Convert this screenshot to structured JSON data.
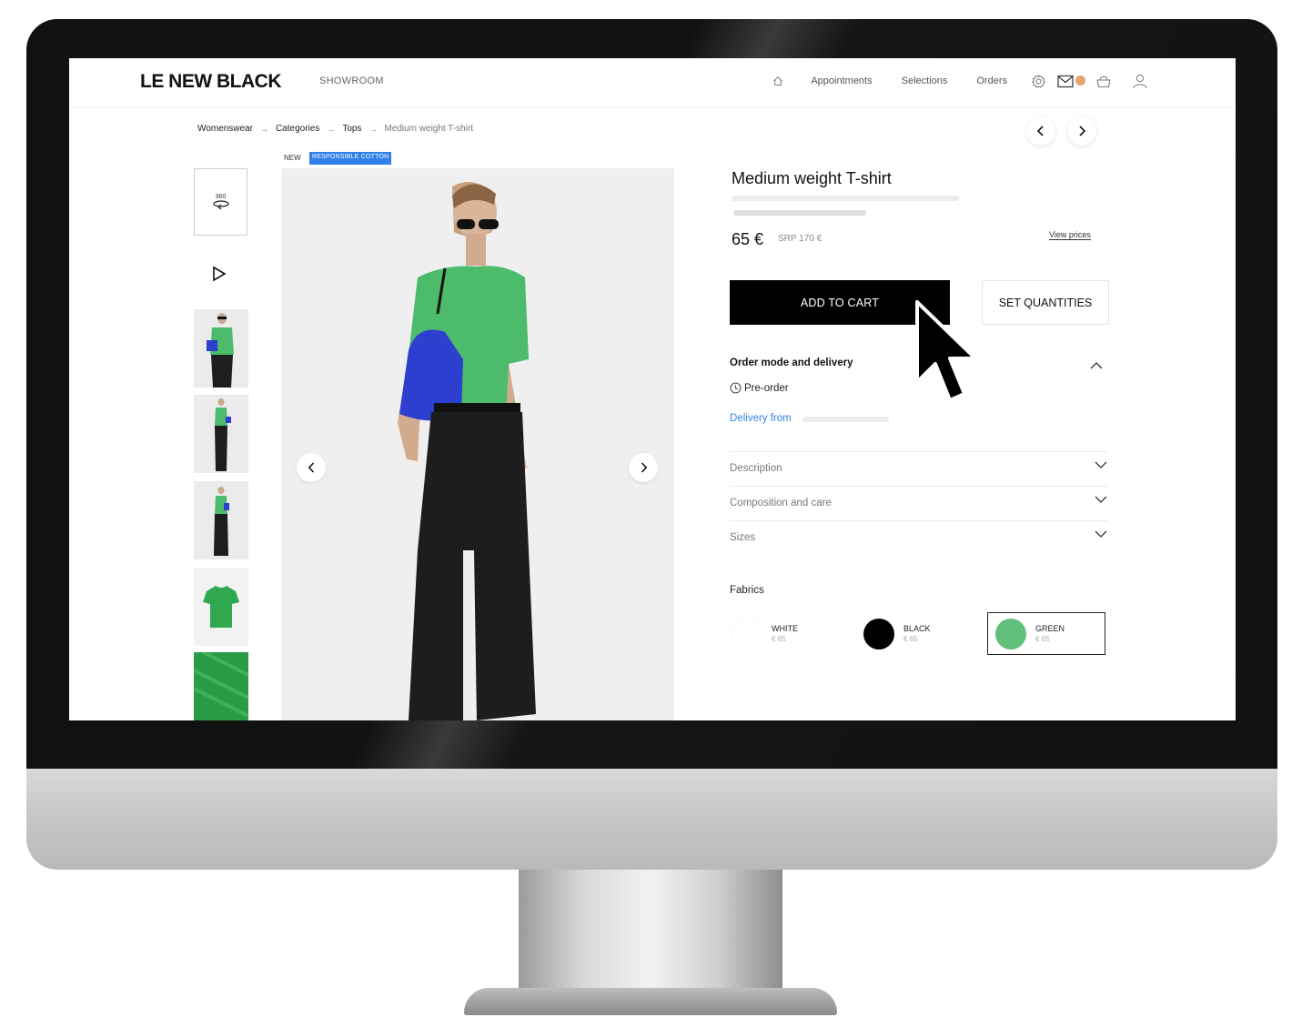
{
  "brand": {
    "logo": "LE NEW BLACK",
    "section": "SHOWROOM"
  },
  "nav": {
    "items": [
      "Appointments",
      "Selections",
      "Orders"
    ]
  },
  "breadcrumb": {
    "items": [
      "Womenswear",
      "Categories",
      "Tops",
      "Medium weight T-shirt"
    ]
  },
  "tags": {
    "new": "NEW",
    "cotton": "RESPONSIBLE COTTON"
  },
  "thumbs": {
    "label_360": "360"
  },
  "product": {
    "title": "Medium weight T-shirt",
    "price": "65 €",
    "srp": "SRP 170 €",
    "view_prices": "View prices",
    "add_to_cart": "ADD TO CART",
    "set_quantities": "SET QUANTITIES"
  },
  "order": {
    "title": "Order mode and delivery",
    "mode": "Pre-order",
    "delivery_from": "Delivery from"
  },
  "accordion": [
    "Description",
    "Composition and care",
    "Sizes"
  ],
  "fabrics": {
    "title": "Fabrics",
    "items": [
      {
        "name": "WHITE",
        "price": "€ 65",
        "color": "#ffffff"
      },
      {
        "name": "BLACK",
        "price": "€ 65",
        "color": "#000000"
      },
      {
        "name": "GREEN",
        "price": "€ 65",
        "color": "#5fbf7b"
      }
    ]
  },
  "colors": {
    "accent_blue": "#2f80e8",
    "notification": "#e8a36b",
    "shirt_green": "#4cbb6c"
  }
}
